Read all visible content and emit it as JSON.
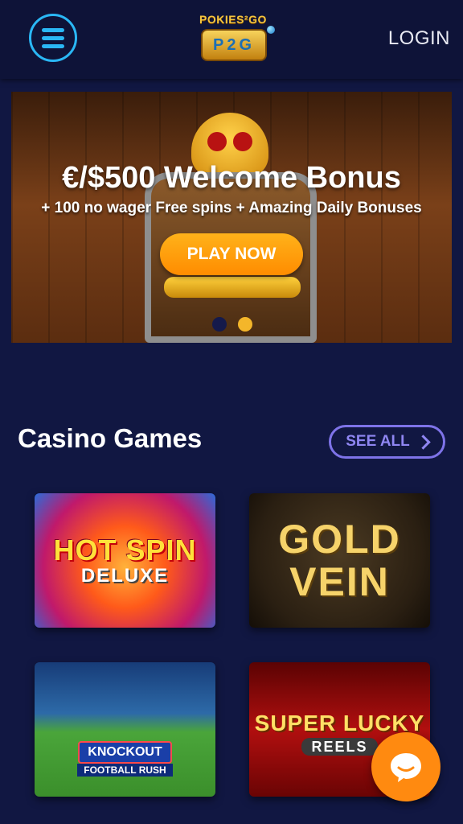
{
  "header": {
    "logo_top": "POKIES²GO",
    "logo_badge": "P2G",
    "login_label": "LOGIN"
  },
  "hero": {
    "title": "€/$500 Welcome Bonus",
    "subtitle": "+ 100 no wager Free spins + Amazing Daily Bonuses",
    "cta_label": "PLAY NOW",
    "slides_count": 2,
    "active_slide": 2
  },
  "casino_games": {
    "heading": "Casino Games",
    "see_all_label": "SEE ALL",
    "games": [
      {
        "title": "HOT SPIN",
        "subtitle": "DELUXE"
      },
      {
        "title": "GOLD",
        "subtitle": "VEIN"
      },
      {
        "title": "KNOCKOUT",
        "subtitle": "FOOTBALL RUSH"
      },
      {
        "title": "SUPER LUCKY",
        "subtitle": "REELS"
      }
    ]
  },
  "colors": {
    "background": "#111742",
    "accent_blue": "#2ab7f5",
    "cta_orange": "#ff8c00",
    "see_all_purple": "#7e73e8"
  },
  "icons": {
    "menu": "hamburger-menu-icon",
    "see_all": "chevron-right-icon",
    "chat": "chat-bubble-icon"
  }
}
